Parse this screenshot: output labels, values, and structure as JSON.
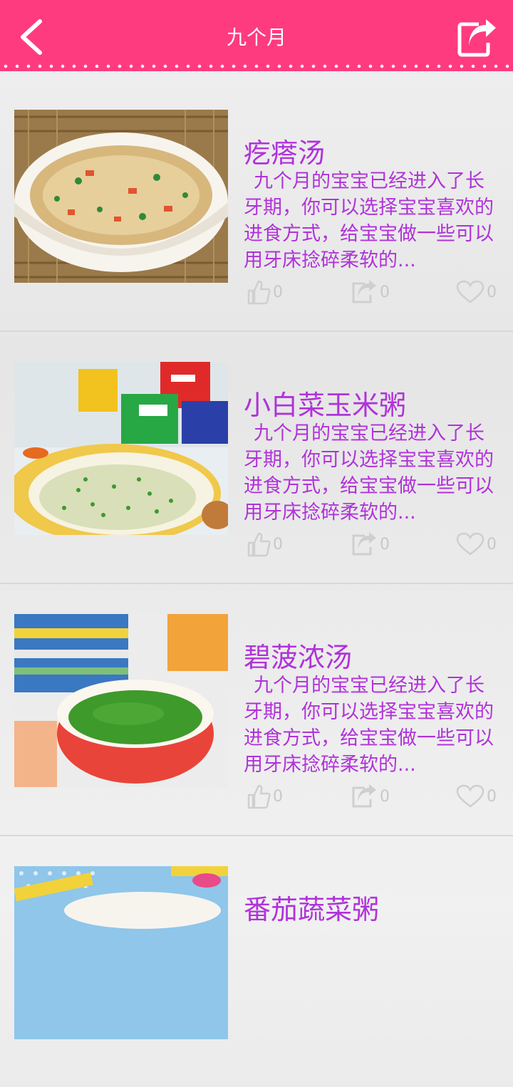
{
  "header": {
    "title": "九个月",
    "back_icon": "chevron-left-icon",
    "share_icon": "share-icon"
  },
  "colors": {
    "brand": "#ff3b7f",
    "accent_text": "#b033d9",
    "stat_gray": "#c8c8c8"
  },
  "items": [
    {
      "title": "疙瘩汤",
      "desc": "九个月的宝宝已经进入了长牙期，你可以选择宝宝喜欢的进食方式，给宝宝做一些可以用牙床捻碎柔软的...",
      "likes": "0",
      "shares": "0",
      "favorites": "0"
    },
    {
      "title": "小白菜玉米粥",
      "desc": "九个月的宝宝已经进入了长牙期，你可以选择宝宝喜欢的进食方式，给宝宝做一些可以用牙床捻碎柔软的...",
      "likes": "0",
      "shares": "0",
      "favorites": "0"
    },
    {
      "title": "碧菠浓汤",
      "desc": "九个月的宝宝已经进入了长牙期，你可以选择宝宝喜欢的进食方式，给宝宝做一些可以用牙床捻碎柔软的...",
      "likes": "0",
      "shares": "0",
      "favorites": "0"
    },
    {
      "title": "番茄蔬菜粥",
      "desc": "",
      "likes": "",
      "shares": "",
      "favorites": ""
    }
  ]
}
